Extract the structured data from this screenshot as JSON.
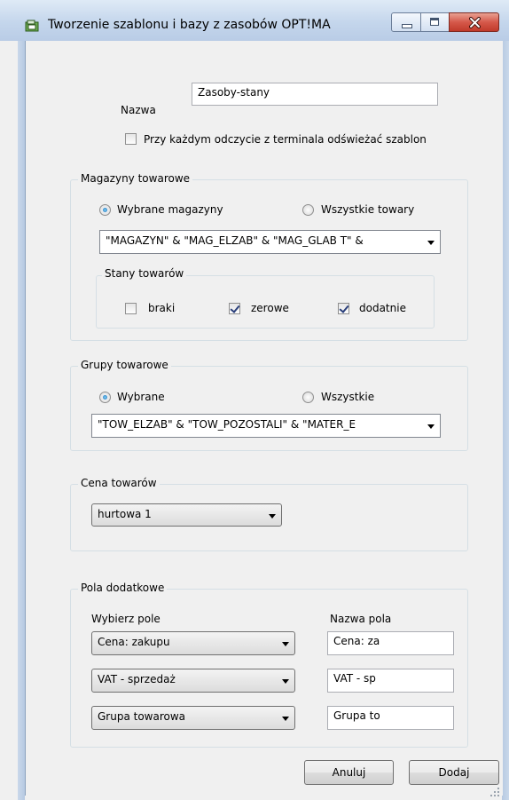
{
  "window": {
    "title": "Tworzenie szablonu i bazy z zasobów OPT!MA",
    "controls": {
      "minimize_icon": "minimize-icon",
      "maximize_icon": "maximize-icon",
      "close_icon": "close-icon"
    }
  },
  "form": {
    "name_label": "Nazwa",
    "name_value": "Zasoby-stany",
    "refresh_checkbox_label": "Przy każdym odczycie z terminala odświeżać szablon",
    "refresh_checked": false
  },
  "warehouses": {
    "title": "Magazyny towarowe",
    "radio_selected_label": "Wybrane magazyny",
    "radio_all_label": "Wszystkie towary",
    "selected_value": "\"MAGAZYN\" & \"MAG_ELZAB\" & \"MAG_GLAB T\" &",
    "stock": {
      "title": "Stany towarów",
      "shortages_label": "braki",
      "shortages_checked": false,
      "zero_label": "zerowe",
      "zero_checked": true,
      "positive_label": "dodatnie",
      "positive_checked": true
    }
  },
  "groups": {
    "title": "Grupy towarowe",
    "radio_selected_label": "Wybrane",
    "radio_all_label": "Wszystkie",
    "selected_value": "\"TOW_ELZAB\" & \"TOW_POZOSTALI\" & \"MATER_E"
  },
  "price": {
    "title": "Cena towarów",
    "selected_value": "hurtowa 1"
  },
  "extra_fields": {
    "title": "Pola dodatkowe",
    "choose_header": "Wybierz pole",
    "name_header": "Nazwa pola",
    "rows": [
      {
        "field": "Cena: zakupu",
        "name": "Cena: za"
      },
      {
        "field": "VAT - sprzedaż",
        "name": "VAT - sp"
      },
      {
        "field": "Grupa towarowa",
        "name": "Grupa to"
      }
    ]
  },
  "buttons": {
    "cancel_label": "Anuluj",
    "add_label": "Dodaj"
  },
  "colors": {
    "titlebar": "#c4d6ec",
    "close_button": "#c8463a",
    "dialog_background": "#f0f0f0"
  }
}
